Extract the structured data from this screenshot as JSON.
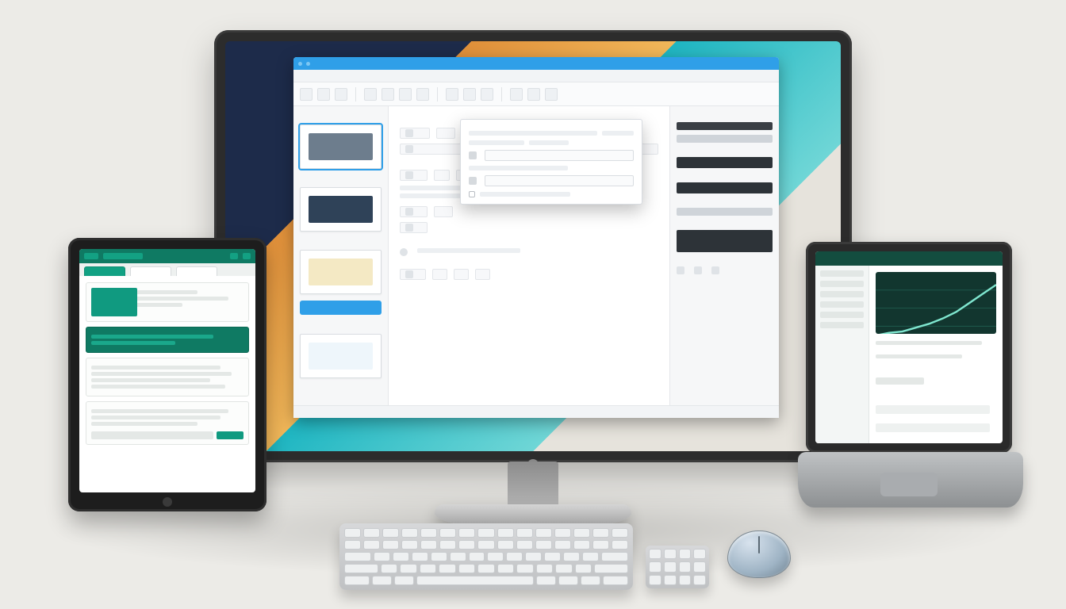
{
  "scene": {
    "description": "Stylized illustration of a desktop workstation: central monitor showing a presentation-style app with a floating dialog, a tablet on the left showing a green-themed dashboard, a small laptop on the right showing an analytics screen with a line chart, plus keyboard, numpad and mouse on a light grey desk.",
    "wallpaper_colors": [
      "#1d2b4a",
      "#e0903a",
      "#1fb6c2",
      "#e6e3dc"
    ]
  },
  "monitor_app": {
    "titlebar": {
      "title": ""
    },
    "menu": [
      "",
      "",
      "",
      "",
      ""
    ],
    "sidebar": {
      "thumb_swatches": [
        "#6d7d8d",
        "#2f4258",
        "#f4e9c4",
        "#eef6fb"
      ],
      "button_label": ""
    },
    "dialog": {
      "heading": "",
      "fields": [
        "",
        "",
        ""
      ],
      "checkbox_label": ""
    },
    "statusbar": {
      "left": "",
      "right": ""
    }
  },
  "tablet_app": {
    "accent": "#109a80",
    "tabs": [
      "",
      "",
      ""
    ]
  },
  "laptop_app": {
    "header": "",
    "accent": "#134d3f",
    "side_items": [
      "",
      "",
      "",
      "",
      "",
      ""
    ]
  },
  "chart_data": {
    "type": "line",
    "title": "",
    "xlabel": "",
    "ylabel": "",
    "x": [
      0,
      1,
      2,
      3,
      4,
      5,
      6,
      7,
      8,
      9
    ],
    "values": [
      8,
      12,
      14,
      20,
      26,
      34,
      44,
      58,
      72,
      86
    ],
    "ylim": [
      0,
      100
    ],
    "note": "Values estimated from an unlabeled rising curve on the laptop screen; no tick labels are visible."
  }
}
